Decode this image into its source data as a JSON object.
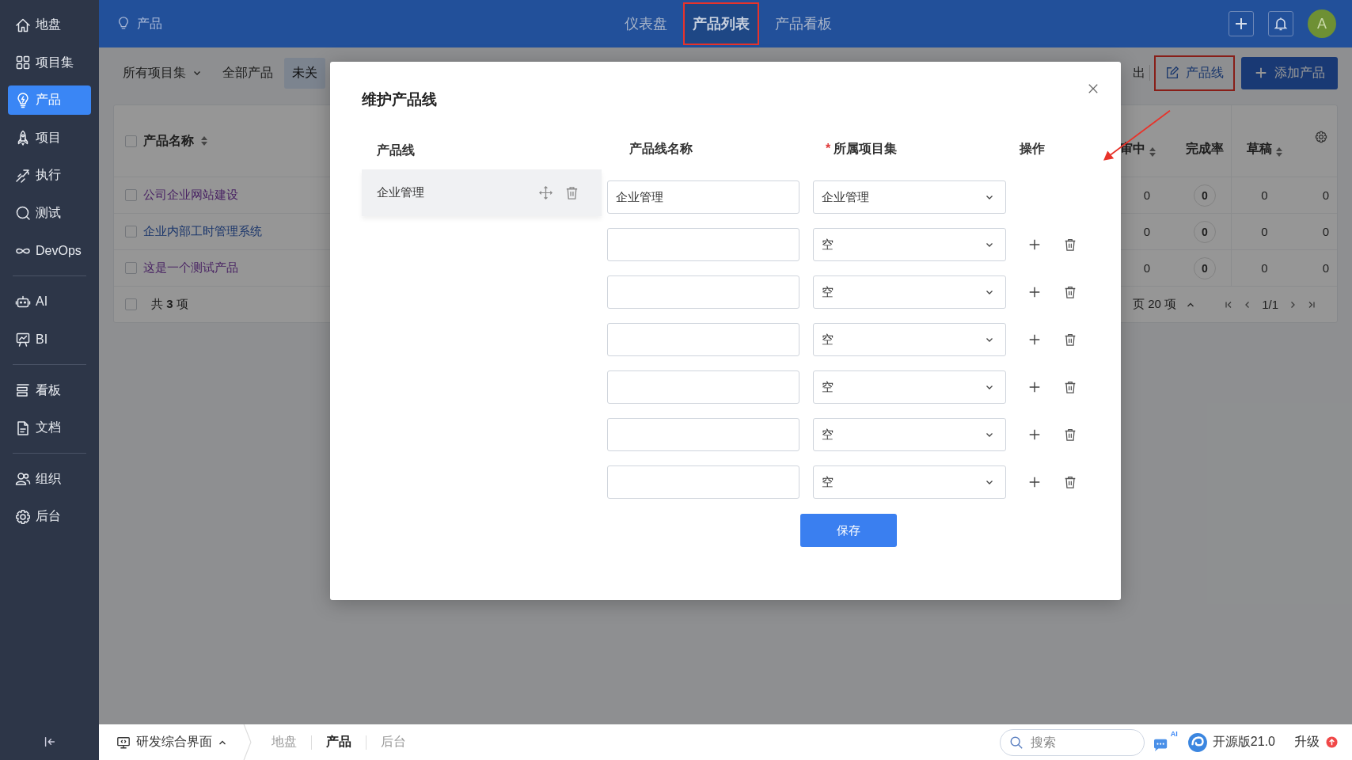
{
  "sidebar": {
    "groups": [
      [
        {
          "label": "地盘",
          "selected": false
        },
        {
          "label": "项目集",
          "selected": false
        },
        {
          "label": "产品",
          "selected": true
        },
        {
          "label": "项目",
          "selected": false
        },
        {
          "label": "执行",
          "selected": false
        },
        {
          "label": "测试",
          "selected": false
        },
        {
          "label": "DevOps",
          "selected": false
        }
      ],
      [
        {
          "label": "AI",
          "selected": false
        },
        {
          "label": "BI",
          "selected": false
        }
      ],
      [
        {
          "label": "看板",
          "selected": false
        },
        {
          "label": "文档",
          "selected": false
        }
      ],
      [
        {
          "label": "组织",
          "selected": false
        },
        {
          "label": "后台",
          "selected": false
        }
      ]
    ]
  },
  "topbar": {
    "breadcrumb": "产品",
    "tabs": [
      {
        "label": "仪表盘",
        "selected": false,
        "highlighted": false
      },
      {
        "label": "产品列表",
        "selected": true,
        "highlighted": true
      },
      {
        "label": "产品看板",
        "selected": false,
        "highlighted": false
      }
    ],
    "avatar": "A"
  },
  "toolbar": {
    "filter": "所有项目集",
    "tabs": [
      {
        "label": "全部产品",
        "selected": false
      },
      {
        "label": "未关",
        "selected": true
      }
    ],
    "export_partial": "出",
    "product_line_button": {
      "label": "产品线",
      "highlighted": true
    },
    "add_button": "添加产品"
  },
  "table": {
    "header_checked": false,
    "footer_checked": false,
    "name_header": "产品名称",
    "columns": [
      {
        "label": "审中",
        "sortable": true
      },
      {
        "label": "完成率",
        "sortable": false
      },
      {
        "label": "草稿",
        "sortable": true
      }
    ],
    "rows": [
      {
        "checked": false,
        "name": "公司企业网站建设",
        "visited": true,
        "reviewing": "0",
        "completion": "0",
        "draft": "0",
        "column_4": "0"
      },
      {
        "checked": false,
        "name": "企业内部工时管理系统",
        "visited": false,
        "reviewing": "0",
        "completion": "0",
        "draft": "0",
        "column_4": "0"
      },
      {
        "checked": false,
        "name": "这是一个测试产品",
        "visited": true,
        "reviewing": "0",
        "completion": "0",
        "draft": "0",
        "column_4": "0"
      }
    ],
    "total": "共 **3** 项",
    "page_size": "页 20 项",
    "page": "1/1"
  },
  "modal": {
    "title": "维护产品线",
    "line_header": "产品线",
    "lines": [
      {
        "name": "企业管理"
      }
    ],
    "columns": [
      {
        "label": "产品线名称"
      },
      {
        "label": "所属项目集",
        "marker": "*"
      },
      {
        "label": "操作"
      }
    ],
    "rows": [
      {
        "name": "企业管理",
        "program": "企业管理",
        "actions": false
      },
      {
        "program": "空",
        "actions": true
      },
      {
        "program": "空",
        "actions": true
      },
      {
        "program": "空",
        "actions": true
      },
      {
        "program": "空",
        "actions": true
      },
      {
        "program": "空",
        "actions": true
      },
      {
        "program": "空",
        "actions": true
      }
    ],
    "save": "保存"
  },
  "bottombar": {
    "workspace": "研发综合界面",
    "crumbs": [
      {
        "label": "地盘",
        "selected": false
      },
      {
        "label": "产品",
        "selected": true
      },
      {
        "label": "后台",
        "selected": false
      }
    ],
    "search_placeholder": "搜索",
    "ai_badge": "AI",
    "version": "开源版21.0",
    "upgrade": "升级"
  }
}
